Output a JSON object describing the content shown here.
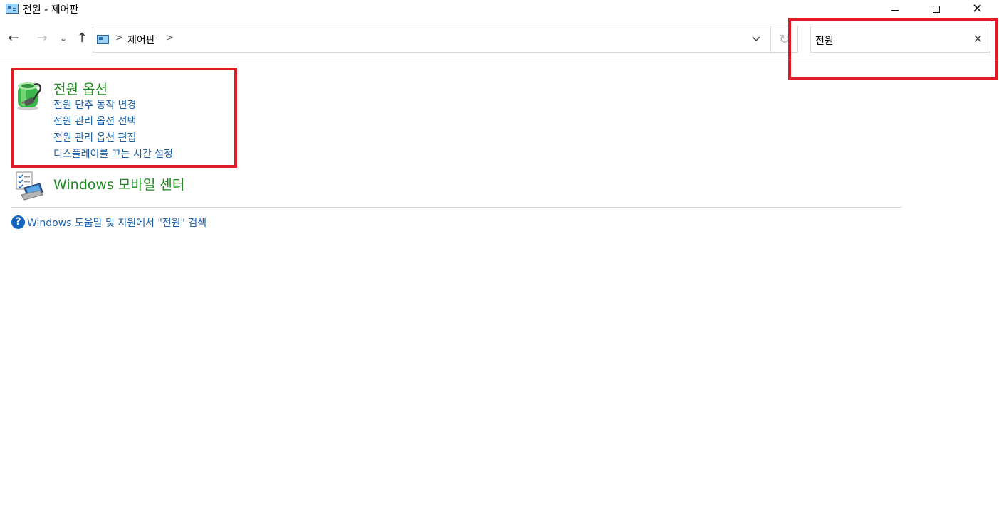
{
  "window": {
    "title": "전원 - 제어판",
    "icon": "control-panel-icon",
    "minimize_icon": "minimize-icon",
    "maximize_icon": "maximize-icon",
    "close_icon": "close-icon"
  },
  "navigation": {
    "back_icon": "←",
    "forward_icon": "→",
    "recent_icon": "⌄",
    "up_icon": "↑",
    "breadcrumb": [
      "제어판"
    ],
    "dropdown_icon": "⌄",
    "refresh_icon": "↻"
  },
  "search": {
    "value": "전원",
    "clear_icon": "✕"
  },
  "results": [
    {
      "title": "전원 옵션",
      "icon": "power-options-icon",
      "links": [
        "전원 단추 동작 변경",
        "전원 관리 옵션 선택",
        "전원 관리 옵션 편집",
        "디스플레이를 끄는 시간 설정"
      ]
    },
    {
      "title": "Windows 모바일 센터",
      "icon": "mobility-center-icon",
      "links": []
    }
  ],
  "help": {
    "icon_glyph": "?",
    "label": "Windows 도움말 및 지원에서 \"전원\" 검색"
  },
  "colors": {
    "highlight_box": "#e11b27",
    "title_green": "#1b8a1b",
    "link_blue": "#1a5fa8"
  }
}
